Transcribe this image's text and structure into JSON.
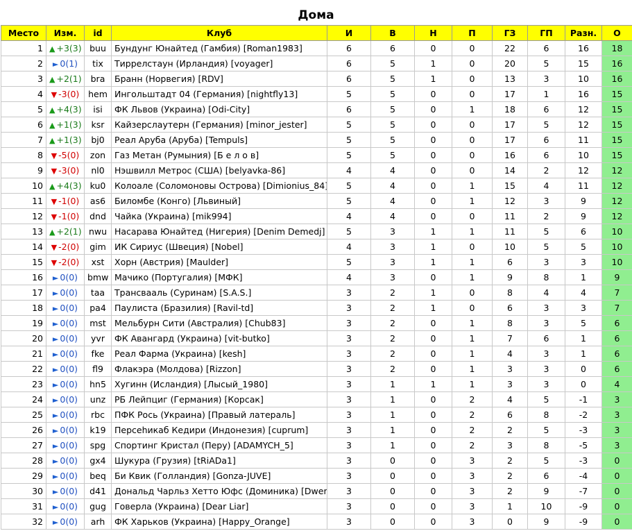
{
  "title": "Дома",
  "columns": [
    "Место",
    "Изм.",
    "id",
    "Клуб",
    "И",
    "В",
    "Н",
    "П",
    "ГЗ",
    "ГП",
    "Разн.",
    "О"
  ],
  "rows": [
    {
      "place": "1",
      "dir": "up",
      "change": "+3(3)",
      "id": "buu",
      "club": "Бундунг Юнайтед (Гамбия) [Roman1983]",
      "g": "6",
      "w": "6",
      "d": "0",
      "l": "0",
      "gf": "22",
      "ga": "6",
      "diff": "16",
      "pts": "18"
    },
    {
      "place": "2",
      "dir": "same",
      "change": "0(1)",
      "id": "tix",
      "club": "Тиррелстаун (Ирландия) [voyager]",
      "g": "6",
      "w": "5",
      "d": "1",
      "l": "0",
      "gf": "20",
      "ga": "5",
      "diff": "15",
      "pts": "16"
    },
    {
      "place": "3",
      "dir": "up",
      "change": "+2(1)",
      "id": "bra",
      "club": "Бранн (Норвегия) [RDV]",
      "g": "6",
      "w": "5",
      "d": "1",
      "l": "0",
      "gf": "13",
      "ga": "3",
      "diff": "10",
      "pts": "16"
    },
    {
      "place": "4",
      "dir": "down",
      "change": "-3(0)",
      "id": "hem",
      "club": "Ингольштадт 04 (Германия) [nightfly13]",
      "g": "5",
      "w": "5",
      "d": "0",
      "l": "0",
      "gf": "17",
      "ga": "1",
      "diff": "16",
      "pts": "15"
    },
    {
      "place": "5",
      "dir": "up",
      "change": "+4(3)",
      "id": "isi",
      "club": "ФК Львов (Украина) [Odi-City]",
      "g": "6",
      "w": "5",
      "d": "0",
      "l": "1",
      "gf": "18",
      "ga": "6",
      "diff": "12",
      "pts": "15"
    },
    {
      "place": "6",
      "dir": "up",
      "change": "+1(3)",
      "id": "ksr",
      "club": "Кайзерслаутерн (Германия) [minor_jester]",
      "g": "5",
      "w": "5",
      "d": "0",
      "l": "0",
      "gf": "17",
      "ga": "5",
      "diff": "12",
      "pts": "15"
    },
    {
      "place": "7",
      "dir": "up",
      "change": "+1(3)",
      "id": "bj0",
      "club": "Реал Аруба (Аруба) [Tempuls]",
      "g": "5",
      "w": "5",
      "d": "0",
      "l": "0",
      "gf": "17",
      "ga": "6",
      "diff": "11",
      "pts": "15"
    },
    {
      "place": "8",
      "dir": "down",
      "change": "-5(0)",
      "id": "zon",
      "club": "Газ Метан (Румыния) [Б е л о в]",
      "g": "5",
      "w": "5",
      "d": "0",
      "l": "0",
      "gf": "16",
      "ga": "6",
      "diff": "10",
      "pts": "15"
    },
    {
      "place": "9",
      "dir": "down",
      "change": "-3(0)",
      "id": "nl0",
      "club": "Нэшвилл Метрос (США) [belyavka-86]",
      "g": "4",
      "w": "4",
      "d": "0",
      "l": "0",
      "gf": "14",
      "ga": "2",
      "diff": "12",
      "pts": "12"
    },
    {
      "place": "10",
      "dir": "up",
      "change": "+4(3)",
      "id": "ku0",
      "club": "Колоале (Соломоновы Острова) [Dimionius_84]",
      "g": "5",
      "w": "4",
      "d": "0",
      "l": "1",
      "gf": "15",
      "ga": "4",
      "diff": "11",
      "pts": "12"
    },
    {
      "place": "11",
      "dir": "down",
      "change": "-1(0)",
      "id": "as6",
      "club": "Биломбе (Конго) [Львиный]",
      "g": "5",
      "w": "4",
      "d": "0",
      "l": "1",
      "gf": "12",
      "ga": "3",
      "diff": "9",
      "pts": "12"
    },
    {
      "place": "12",
      "dir": "down",
      "change": "-1(0)",
      "id": "dnd",
      "club": "Чайка (Украина) [mik994]",
      "g": "4",
      "w": "4",
      "d": "0",
      "l": "0",
      "gf": "11",
      "ga": "2",
      "diff": "9",
      "pts": "12"
    },
    {
      "place": "13",
      "dir": "up",
      "change": "+2(1)",
      "id": "nwu",
      "club": "Насарава Юнайтед (Нигерия) [Denim Demedj]",
      "g": "5",
      "w": "3",
      "d": "1",
      "l": "1",
      "gf": "11",
      "ga": "5",
      "diff": "6",
      "pts": "10"
    },
    {
      "place": "14",
      "dir": "down",
      "change": "-2(0)",
      "id": "gim",
      "club": "ИК Сириус (Швеция) [Nobel]",
      "g": "4",
      "w": "3",
      "d": "1",
      "l": "0",
      "gf": "10",
      "ga": "5",
      "diff": "5",
      "pts": "10"
    },
    {
      "place": "15",
      "dir": "down",
      "change": "-2(0)",
      "id": "xst",
      "club": "Хорн (Австрия) [Maulder]",
      "g": "5",
      "w": "3",
      "d": "1",
      "l": "1",
      "gf": "6",
      "ga": "3",
      "diff": "3",
      "pts": "10"
    },
    {
      "place": "16",
      "dir": "same",
      "change": "0(0)",
      "id": "bmw",
      "club": "Мачико (Португалия) [МФК]",
      "g": "4",
      "w": "3",
      "d": "0",
      "l": "1",
      "gf": "9",
      "ga": "8",
      "diff": "1",
      "pts": "9"
    },
    {
      "place": "17",
      "dir": "same",
      "change": "0(0)",
      "id": "taa",
      "club": "Трансвааль (Суринам) [S.A.S.]",
      "g": "3",
      "w": "2",
      "d": "1",
      "l": "0",
      "gf": "8",
      "ga": "4",
      "diff": "4",
      "pts": "7"
    },
    {
      "place": "18",
      "dir": "same",
      "change": "0(0)",
      "id": "pa4",
      "club": "Паулиста (Бразилия) [Ravil-td]",
      "g": "3",
      "w": "2",
      "d": "1",
      "l": "0",
      "gf": "6",
      "ga": "3",
      "diff": "3",
      "pts": "7"
    },
    {
      "place": "19",
      "dir": "same",
      "change": "0(0)",
      "id": "mst",
      "club": "Мельбурн Сити (Австралия) [Chub83]",
      "g": "3",
      "w": "2",
      "d": "0",
      "l": "1",
      "gf": "8",
      "ga": "3",
      "diff": "5",
      "pts": "6"
    },
    {
      "place": "20",
      "dir": "same",
      "change": "0(0)",
      "id": "yvr",
      "club": "ФК Авангард (Украина) [vit-butko]",
      "g": "3",
      "w": "2",
      "d": "0",
      "l": "1",
      "gf": "7",
      "ga": "6",
      "diff": "1",
      "pts": "6"
    },
    {
      "place": "21",
      "dir": "same",
      "change": "0(0)",
      "id": "fke",
      "club": "Реал Фарма (Украина) [kesh]",
      "g": "3",
      "w": "2",
      "d": "0",
      "l": "1",
      "gf": "4",
      "ga": "3",
      "diff": "1",
      "pts": "6"
    },
    {
      "place": "22",
      "dir": "same",
      "change": "0(0)",
      "id": "fl9",
      "club": "Флакэра (Молдова) [Rizzon]",
      "g": "3",
      "w": "2",
      "d": "0",
      "l": "1",
      "gf": "3",
      "ga": "3",
      "diff": "0",
      "pts": "6"
    },
    {
      "place": "23",
      "dir": "same",
      "change": "0(0)",
      "id": "hn5",
      "club": "Хугинн (Исландия) [Лысый_1980]",
      "g": "3",
      "w": "1",
      "d": "1",
      "l": "1",
      "gf": "3",
      "ga": "3",
      "diff": "0",
      "pts": "4"
    },
    {
      "place": "24",
      "dir": "same",
      "change": "0(0)",
      "id": "unz",
      "club": "РБ Лейпциг (Германия) [Корсак]",
      "g": "3",
      "w": "1",
      "d": "0",
      "l": "2",
      "gf": "4",
      "ga": "5",
      "diff": "-1",
      "pts": "3"
    },
    {
      "place": "25",
      "dir": "same",
      "change": "0(0)",
      "id": "rbc",
      "club": "ПФК Рось (Украина) [Правый латераль]",
      "g": "3",
      "w": "1",
      "d": "0",
      "l": "2",
      "gf": "6",
      "ga": "8",
      "diff": "-2",
      "pts": "3"
    },
    {
      "place": "26",
      "dir": "same",
      "change": "0(0)",
      "id": "k19",
      "club": "Персеһикаб Кедири (Индонезия) [cuprum]",
      "g": "3",
      "w": "1",
      "d": "0",
      "l": "2",
      "gf": "2",
      "ga": "5",
      "diff": "-3",
      "pts": "3"
    },
    {
      "place": "27",
      "dir": "same",
      "change": "0(0)",
      "id": "spg",
      "club": "Спортинг Кристал (Перу) [ADAMYCH_5]",
      "g": "3",
      "w": "1",
      "d": "0",
      "l": "2",
      "gf": "3",
      "ga": "8",
      "diff": "-5",
      "pts": "3"
    },
    {
      "place": "28",
      "dir": "same",
      "change": "0(0)",
      "id": "gx4",
      "club": "Шукура (Грузия) [tRiADa1]",
      "g": "3",
      "w": "0",
      "d": "0",
      "l": "3",
      "gf": "2",
      "ga": "5",
      "diff": "-3",
      "pts": "0"
    },
    {
      "place": "29",
      "dir": "same",
      "change": "0(0)",
      "id": "beq",
      "club": "Би Квик (Голландия) [Gonza-JUVE]",
      "g": "3",
      "w": "0",
      "d": "0",
      "l": "3",
      "gf": "2",
      "ga": "6",
      "diff": "-4",
      "pts": "0"
    },
    {
      "place": "30",
      "dir": "same",
      "change": "0(0)",
      "id": "d41",
      "club": "Дональд Чарльз Хетто Юфс (Доминика) [Dwem]",
      "g": "3",
      "w": "0",
      "d": "0",
      "l": "3",
      "gf": "2",
      "ga": "9",
      "diff": "-7",
      "pts": "0"
    },
    {
      "place": "31",
      "dir": "same",
      "change": "0(0)",
      "id": "gug",
      "club": "Говерла (Украина) [Dear Liar]",
      "g": "3",
      "w": "0",
      "d": "0",
      "l": "3",
      "gf": "1",
      "ga": "10",
      "diff": "-9",
      "pts": "0"
    },
    {
      "place": "32",
      "dir": "same",
      "change": "0(0)",
      "id": "arh",
      "club": "ФК Харьков (Украина) [Happy_Orange]",
      "g": "3",
      "w": "0",
      "d": "0",
      "l": "3",
      "gf": "0",
      "ga": "9",
      "diff": "-9",
      "pts": "0"
    }
  ],
  "arrows": {
    "up": "▲",
    "down": "▼",
    "same": "►"
  },
  "colors": {
    "header_bg": "#ffff00",
    "points_bg": "#90ee90",
    "up": "#1a9a1a",
    "down": "#dd0000",
    "same": "#2060d0"
  }
}
